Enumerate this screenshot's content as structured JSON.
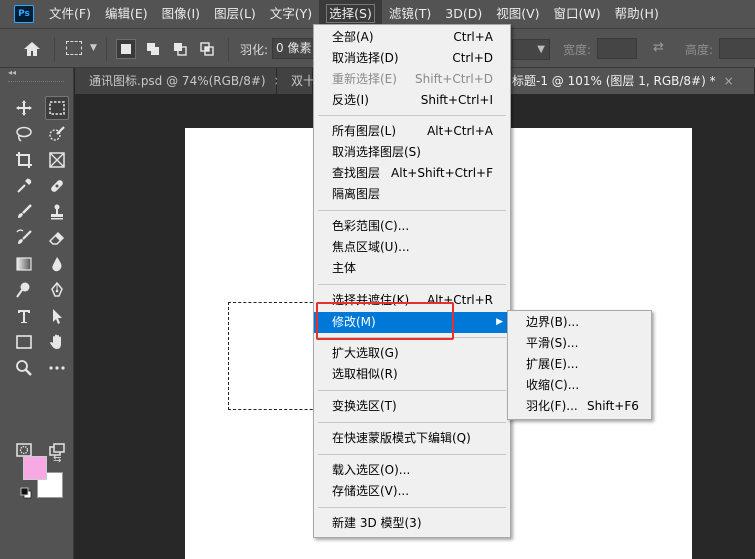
{
  "app": {
    "logo": "Ps"
  },
  "menubar": {
    "items": [
      "文件(F)",
      "编辑(E)",
      "图像(I)",
      "图层(L)",
      "文字(Y)",
      "选择(S)",
      "滤镜(T)",
      "3D(D)",
      "视图(V)",
      "窗口(W)",
      "帮助(H)"
    ],
    "active_index": 5
  },
  "options": {
    "feather_label": "羽化:",
    "feather_value": "0 像素",
    "width_label": "宽度:",
    "height_label": "高度:",
    "swap_glyph": "⇄"
  },
  "tabs": [
    {
      "label": "通讯图标.psd @ 74%(RGB/8#)",
      "close": "×",
      "active": false
    },
    {
      "label": "双十",
      "close": "",
      "active": false
    },
    {
      "label": "标题-1 @ 101% (图层 1, RGB/8#) *",
      "close": "×",
      "active": true
    }
  ],
  "select_menu": {
    "items": [
      {
        "label": "全部(A)",
        "shortcut": "Ctrl+A"
      },
      {
        "label": "取消选择(D)",
        "shortcut": "Ctrl+D"
      },
      {
        "label": "重新选择(E)",
        "shortcut": "Shift+Ctrl+D",
        "disabled": true
      },
      {
        "label": "反选(I)",
        "shortcut": "Shift+Ctrl+I"
      },
      {
        "label": "所有图层(L)",
        "shortcut": "Alt+Ctrl+A"
      },
      {
        "label": "取消选择图层(S)",
        "shortcut": ""
      },
      {
        "label": "查找图层",
        "shortcut": "Alt+Shift+Ctrl+F"
      },
      {
        "label": "隔离图层",
        "shortcut": ""
      },
      {
        "label": "色彩范围(C)...",
        "shortcut": ""
      },
      {
        "label": "焦点区域(U)...",
        "shortcut": ""
      },
      {
        "label": "主体",
        "shortcut": ""
      },
      {
        "label": "选择并遮住(K)...",
        "shortcut": "Alt+Ctrl+R"
      },
      {
        "label": "修改(M)",
        "shortcut": "",
        "submenu": true,
        "highlighted": true
      },
      {
        "label": "扩大选取(G)",
        "shortcut": ""
      },
      {
        "label": "选取相似(R)",
        "shortcut": ""
      },
      {
        "label": "变换选区(T)",
        "shortcut": ""
      },
      {
        "label": "在快速蒙版模式下编辑(Q)",
        "shortcut": ""
      },
      {
        "label": "载入选区(O)...",
        "shortcut": ""
      },
      {
        "label": "存储选区(V)...",
        "shortcut": ""
      },
      {
        "label": "新建 3D 模型(3)",
        "shortcut": ""
      }
    ]
  },
  "modify_submenu": {
    "items": [
      {
        "label": "边界(B)...",
        "shortcut": ""
      },
      {
        "label": "平滑(S)...",
        "shortcut": ""
      },
      {
        "label": "扩展(E)...",
        "shortcut": ""
      },
      {
        "label": "收缩(C)...",
        "shortcut": ""
      },
      {
        "label": "羽化(F)...",
        "shortcut": "Shift+F6"
      }
    ]
  },
  "colors": {
    "foreground": "#f7a9e6",
    "background": "#ffffff",
    "highlight": "#0078d7",
    "callout": "#e6302b"
  }
}
